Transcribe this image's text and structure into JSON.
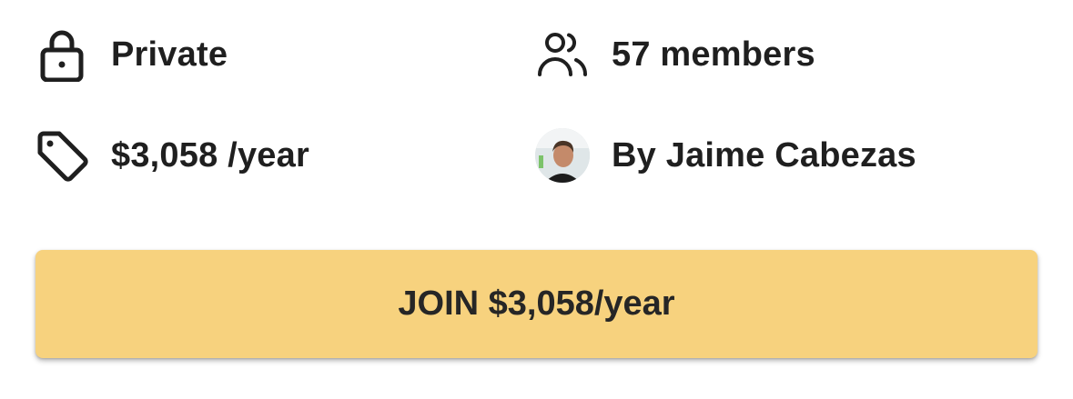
{
  "details": {
    "privacy": {
      "label": "Private",
      "icon": "lock-icon"
    },
    "members": {
      "label": "57 members",
      "icon": "users-icon"
    },
    "price": {
      "label": "$3,058 /year",
      "icon": "price-tag-icon"
    },
    "author": {
      "label": "By Jaime Cabezas",
      "icon": "avatar"
    }
  },
  "join_button": {
    "label": "JOIN $3,058/year"
  },
  "colors": {
    "button_bg": "#f7d27e",
    "text": "#1f1f1f"
  }
}
